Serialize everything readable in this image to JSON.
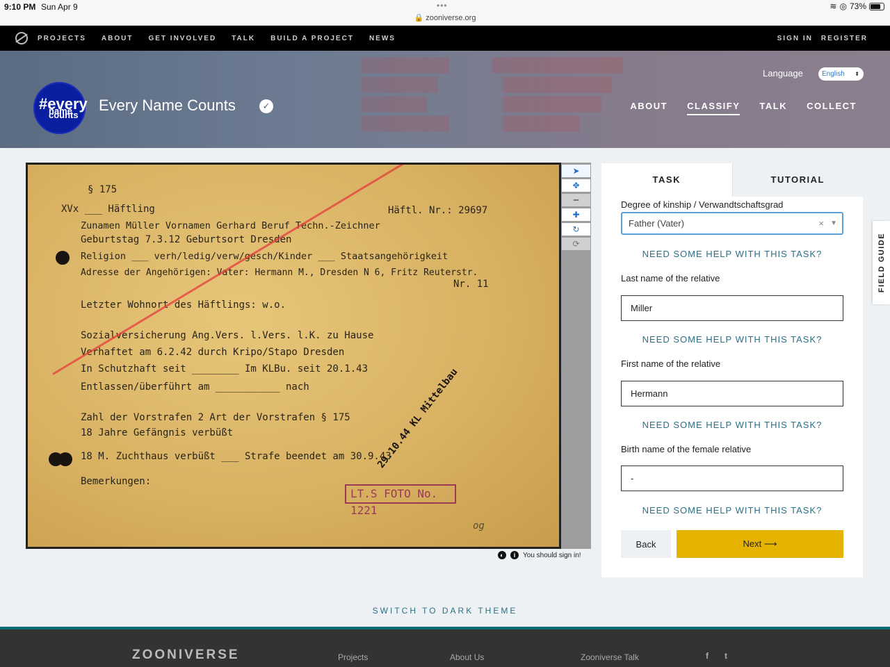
{
  "status_bar": {
    "time": "9:10 PM",
    "date": "Sun Apr 9",
    "url": "zooniverse.org",
    "battery": "73%"
  },
  "top_nav": {
    "items": [
      "PROJECTS",
      "ABOUT",
      "GET INVOLVED",
      "TALK",
      "BUILD A PROJECT",
      "NEWS"
    ],
    "sign_in": "SIGN IN",
    "register": "REGISTER"
  },
  "project": {
    "avatar_text": {
      "hash": "#every",
      "line2": "name",
      "line3": "counts"
    },
    "title": "Every Name Counts",
    "language_label": "Language",
    "language_value": "English",
    "nav": [
      "ABOUT",
      "CLASSIFY",
      "TALK",
      "COLLECT"
    ],
    "active_nav": "CLASSIFY"
  },
  "subject": {
    "lines": [
      "§ 175",
      "XVx ___ Häftling",
      "Häftl. Nr.: 29697",
      "Zunamen  Müller    Vornamen   Gerhard  Beruf  Techn.-Zeichner",
      "Geburtstag  7.3.12  Geburtsort  Dresden",
      "Religion ___ verh/ledig/verw/gesch/Kinder ___ Staatsangehörigkeit",
      "Adresse der Angehörigen: Vater: Hermann M., Dresden N 6, Fritz Reuterstr.",
      "Nr. 11",
      "Letzter Wohnort des Häftlings: w.o.",
      "Sozialversicherung  Ang.Vers. l.Vers. l.K. zu Hause",
      "Verhaftet am  6.2.42   durch Kripo/Stapo   Dresden",
      "In Schutzhaft seit ________ Im KLBu. seit 20.1.43",
      "Entlassen/überführt am ___________ nach",
      "Zahl der Vorstrafen 2  Art der Vorstrafen  § 175",
      "18 Jahre Gefängnis verbüßt",
      "18 M. Zuchthaus verbüßt ___ Strafe beendet am  30.9.43",
      "Bemerkungen:",
      "og"
    ],
    "diag_stamp": "29.10.44 KL Mittelbau",
    "box_stamp": "LT.S FOTO No. 1221",
    "signin_note": "You should sign in!"
  },
  "toolbar": [
    "pointer-icon",
    "move-icon",
    "zoom-out-icon",
    "zoom-in-icon",
    "rotate-icon",
    "reset-icon"
  ],
  "task": {
    "tab_task": "TASK",
    "tab_tutorial": "TUTORIAL",
    "degree_label": "Degree of kinship / Verwandtschaftsgrad",
    "degree_value": "Father (Vater)",
    "help": "NEED SOME HELP WITH THIS TASK?",
    "last_name_label": "Last name of the relative",
    "last_name_value": "Miller",
    "first_name_label": "First name of the relative",
    "first_name_value": "Hermann",
    "birth_name_label": "Birth name of the female relative",
    "birth_name_value": "-",
    "back": "Back",
    "next": "Next ⟶"
  },
  "field_guide": "FIELD GUIDE",
  "dark_theme": "SWITCH TO DARK THEME",
  "footer": {
    "logo": "ZOONIVERSE",
    "links": [
      "Projects",
      "About Us",
      "Zooniverse Talk"
    ]
  }
}
